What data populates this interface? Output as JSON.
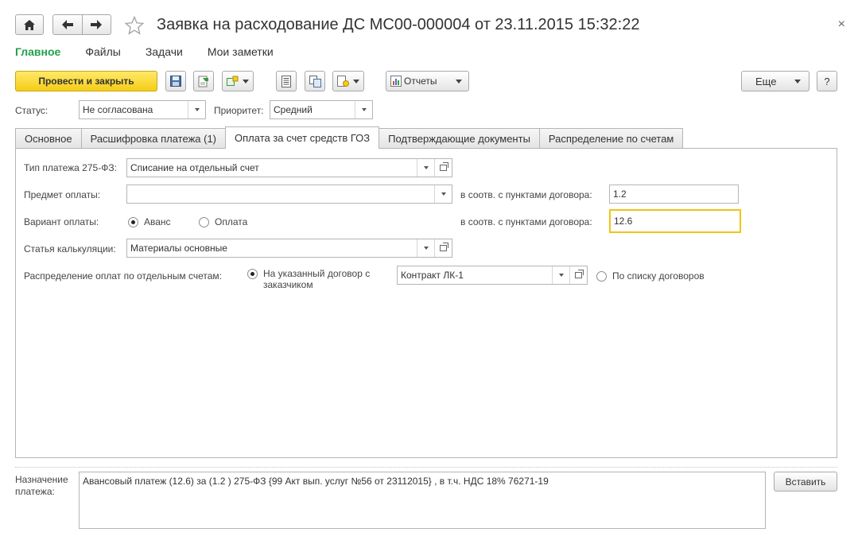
{
  "window": {
    "title": "Заявка на расходование ДС МС00-000004 от 23.11.2015 15:32:22",
    "close_glyph": "×"
  },
  "nav": {
    "items": [
      "Главное",
      "Файлы",
      "Задачи",
      "Мои заметки"
    ],
    "active_index": 0
  },
  "toolbar": {
    "post_close_label": "Провести и закрыть",
    "reports_label": "Отчеты",
    "more_label": "Еще",
    "help_label": "?"
  },
  "header": {
    "status_label": "Статус:",
    "status_value": "Не согласована",
    "priority_label": "Приоритет:",
    "priority_value": "Средний"
  },
  "tabs": [
    {
      "label": "Основное"
    },
    {
      "label": "Расшифровка платежа (1)"
    },
    {
      "label": "Оплата за счет средств ГОЗ"
    },
    {
      "label": "Подтверждающие документы"
    },
    {
      "label": "Распределение по счетам"
    }
  ],
  "tab_active_index": 2,
  "form": {
    "payment_type_label": "Тип платежа 275-ФЗ:",
    "payment_type_value": "Списание на отдельный счет",
    "payment_subject_label": "Предмет оплаты:",
    "payment_subject_value": "",
    "contract_points_label_1": "в соотв. с пунктами договора:",
    "contract_points_value_1": "1.2",
    "payment_variant_label": "Вариант оплаты:",
    "variant_advance": "Аванс",
    "variant_payment": "Оплата",
    "variant_selected": "Аванс",
    "contract_points_label_2": "в соотв. с пунктами договора:",
    "contract_points_value_2": "12.6",
    "cost_item_label": "Статья калькуляции:",
    "cost_item_value": "Материалы основные",
    "distribution_label": "Распределение оплат по отдельным счетам:",
    "dist_option_specified_line1": "На указанный договор с",
    "dist_option_specified_line2": "заказчиком",
    "contract_value": "Контракт ЛК-1",
    "dist_option_list": "По списку договоров",
    "dist_selected": "specified"
  },
  "footer": {
    "purpose_label_line1": "Назначение",
    "purpose_label_line2": "платежа:",
    "purpose_text": "Авансовый платеж (12.6) за  (1.2 ) 275-ФЗ {99 Акт вып. услуг №56 от 23112015} , в т.ч. НДС 18% 76271-19",
    "insert_label": "Вставить"
  },
  "colors": {
    "accent_green": "#23a04a",
    "primary_yellow": "#f5cd15",
    "focus_border": "#f0c419"
  }
}
